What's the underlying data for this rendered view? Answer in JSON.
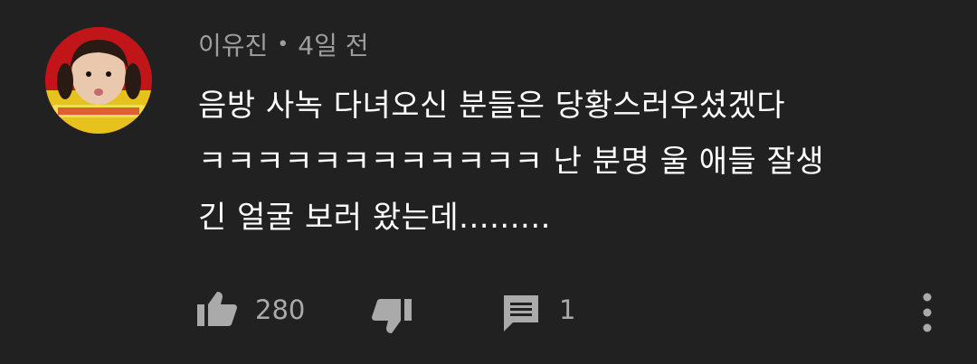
{
  "comment": {
    "author": "이유진",
    "separator": "•",
    "time": "4일 전",
    "text_lines": [
      "음방 사녹 다녀오신 분들은 당황스러우셨겠다",
      "ㅋㅋㅋㅋㅋㅋㅋㅋㅋㅋㅋㅋ 난 분명 울 애들 잘생",
      "긴 얼굴 보러 왔는데........."
    ],
    "avatar_icon": "user-avatar-photo"
  },
  "actions": {
    "like_icon": "thumbs-up-icon",
    "like_count": "280",
    "dislike_icon": "thumbs-down-icon",
    "reply_icon": "comment-icon",
    "reply_count": "1",
    "menu_icon": "more-vertical-icon"
  },
  "colors": {
    "background": "#212121",
    "text_primary": "#ffffff",
    "text_secondary": "#9e9e9e",
    "icon": "#aaaaaa"
  }
}
